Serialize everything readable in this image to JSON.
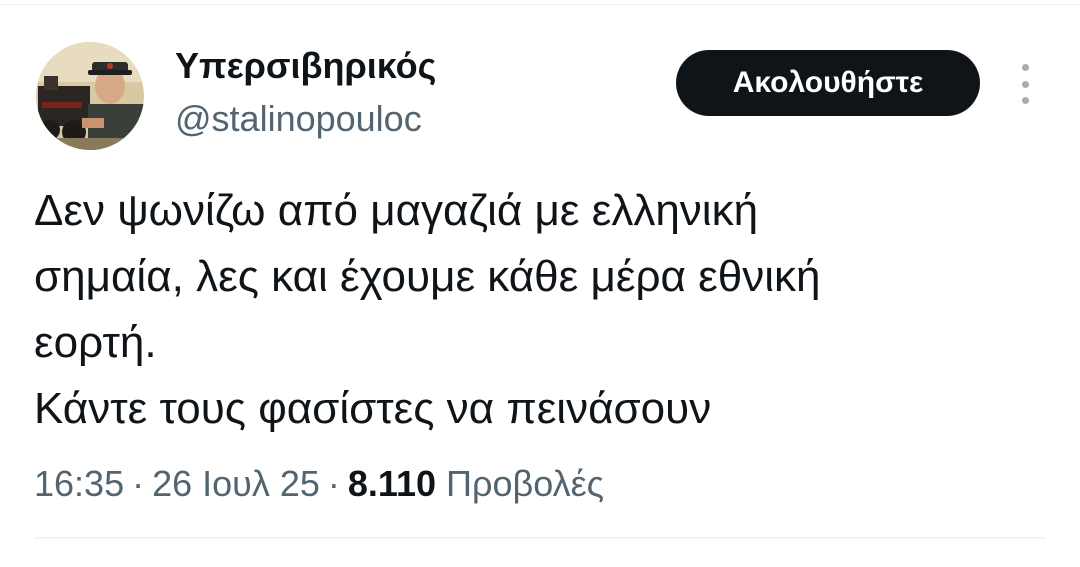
{
  "author": {
    "display_name": "Υπερσιβηρικός",
    "handle": "@stalinopouloc"
  },
  "actions": {
    "follow_label": "Ακολουθήστε",
    "more_icon": "more-vertical-icon"
  },
  "tweet": {
    "lines": [
      "Δεν ψωνίζω από μαγαζιά με ελληνική",
      "σημαία, λες και έχουμε κάθε μέρα εθνική",
      "εορτή.",
      "Κάντε τους φασίστες να πεινάσουν"
    ]
  },
  "meta": {
    "time": "16:35",
    "separator": "·",
    "date": "26 Ιουλ 25",
    "views_count": "8.110",
    "views_label": "Προβολές"
  },
  "colors": {
    "text_primary": "#0f1419",
    "text_secondary": "#536471",
    "button_bg": "#0f1419",
    "divider": "#eff3f4"
  }
}
